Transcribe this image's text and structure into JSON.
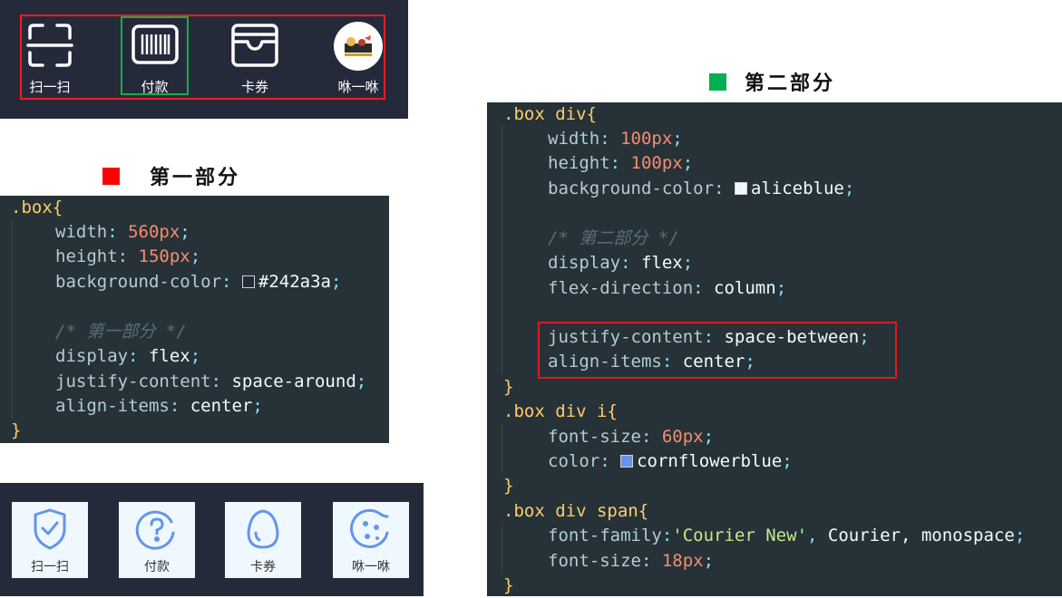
{
  "top_bar": {
    "items": [
      {
        "label": "扫一扫",
        "icon": "scan-icon"
      },
      {
        "label": "付款",
        "icon": "barcode-icon"
      },
      {
        "label": "卡券",
        "icon": "wallet-icon"
      },
      {
        "label": "咻一咻",
        "icon": "avatar-icon"
      }
    ],
    "outline_color": "#ff1a1a",
    "active_outline_color": "#1aaa4a"
  },
  "section1": {
    "title": "第一部分",
    "marker_color": "#ff0000"
  },
  "section2": {
    "title": "第二部分",
    "marker_color": "#00b050"
  },
  "code1": {
    "sel": ".box",
    "open": "{",
    "close": "}",
    "p1": "width",
    "v1": "560px",
    "p2": "height",
    "v2": "150px",
    "p3": "background-color",
    "v3": "#242a3a",
    "v3_swatch": "#242a3a",
    "comment": "/* 第一部分 */",
    "p4": "display",
    "v4": "flex",
    "p5": "justify-content",
    "v5": "space-around",
    "p6": "align-items",
    "v6": "center"
  },
  "code2": {
    "sel1": ".box div",
    "open": "{",
    "close": "}",
    "p1": "width",
    "v1": "100px",
    "p2": "height",
    "v2": "100px",
    "p3": "background-color",
    "v3": "aliceblue",
    "v3_swatch": "#f0f8ff",
    "comment": "/* 第二部分 */",
    "p4": "display",
    "v4": "flex",
    "p5": "flex-direction",
    "v5": "column",
    "p6": "justify-content",
    "v6": "space-between",
    "p7": "align-items",
    "v7": "center",
    "sel2": ".box div i",
    "p8": "font-size",
    "v8": "60px",
    "p9": "color",
    "v9": "cornflowerblue",
    "v9_swatch": "#6495ed",
    "sel3": ".box div span",
    "p10": "font-family",
    "v10a": "'Courier New'",
    "v10b": "Courier, monospace",
    "p11": "font-size",
    "v11": "18px"
  },
  "bottom_bar": {
    "items": [
      {
        "label": "扫一扫",
        "icon": "shield-check-icon"
      },
      {
        "label": "付款",
        "icon": "question-circle-icon"
      },
      {
        "label": "卡券",
        "icon": "egg-icon"
      },
      {
        "label": "咻一咻",
        "icon": "cookie-icon"
      }
    ],
    "icon_color": "#6495ed",
    "tile_color": "#f0f8ff"
  }
}
